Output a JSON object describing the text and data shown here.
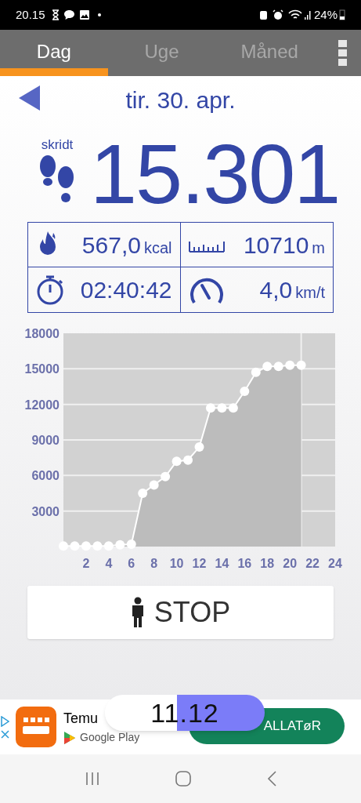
{
  "status_bar": {
    "time": "20.15",
    "battery": "24%"
  },
  "tabs": [
    {
      "label": "Dag",
      "selected": true
    },
    {
      "label": "Uge",
      "selected": false
    },
    {
      "label": "Måned",
      "selected": false
    }
  ],
  "date": "tir. 30. apr.",
  "steps": {
    "label": "skridt",
    "value": "15.301"
  },
  "stats": [
    {
      "kind": "calories",
      "value": "567,0",
      "unit": "kcal"
    },
    {
      "kind": "distance",
      "value": "10710",
      "unit": "m"
    },
    {
      "kind": "time",
      "value": "02:40:42"
    },
    {
      "kind": "speed",
      "value": "4,0",
      "unit": "km/t"
    }
  ],
  "chart_data": {
    "type": "area",
    "x": [
      0,
      1,
      2,
      3,
      4,
      5,
      6,
      7,
      8,
      9,
      10,
      11,
      12,
      13,
      14,
      15,
      16,
      17,
      18,
      19,
      20,
      21
    ],
    "series": [
      {
        "color": "#ffffff",
        "values": [
          50,
          50,
          50,
          50,
          50,
          150,
          200,
          4500,
          5200,
          5900,
          7200,
          7300,
          8400,
          11700,
          11700,
          11700,
          13100,
          14700,
          15200,
          15200,
          15300,
          15300
        ]
      }
    ],
    "grid": true,
    "xlim": [
      0,
      24
    ],
    "ylim": [
      0,
      18000
    ],
    "xticks": [
      2,
      4,
      6,
      8,
      10,
      12,
      14,
      16,
      18,
      20,
      22,
      24
    ],
    "yticks": [
      3000,
      6000,
      9000,
      12000,
      15000,
      18000
    ]
  },
  "stop_button": "STOP",
  "ad": {
    "app": "Temu",
    "store": "Google Play",
    "button": "ALLATøR"
  },
  "overlay_pill": "11.12"
}
